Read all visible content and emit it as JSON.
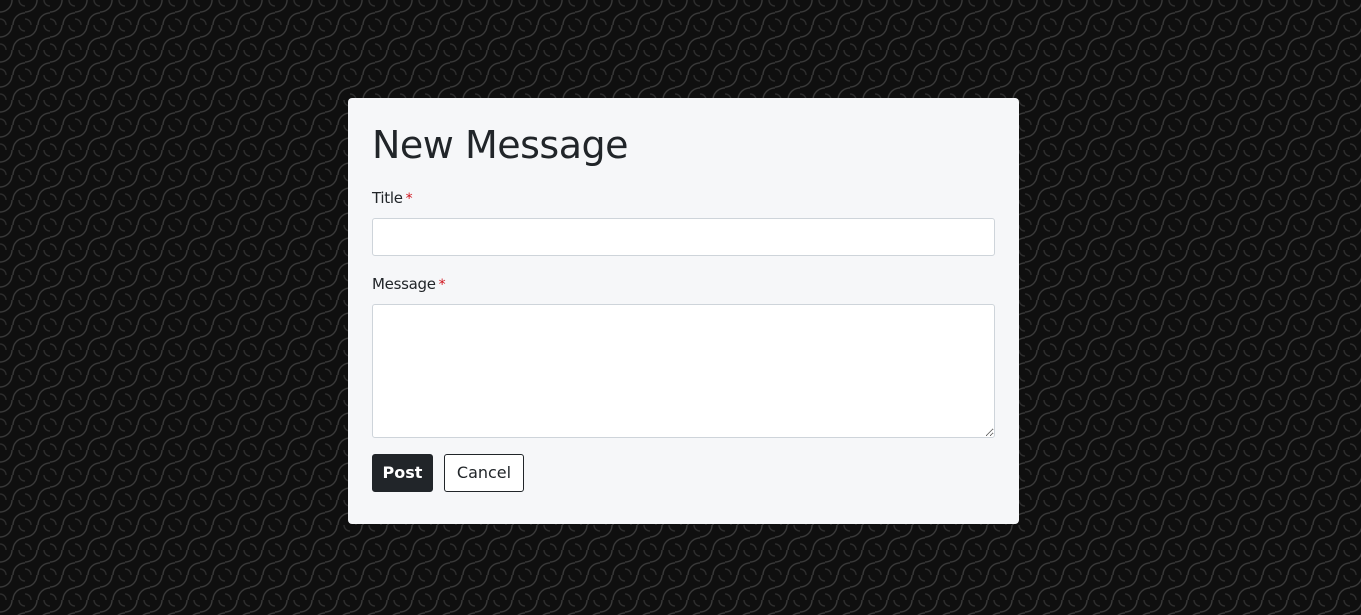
{
  "dialog": {
    "heading": "New Message",
    "fields": {
      "title": {
        "label": "Title",
        "required_marker": "*",
        "value": "",
        "placeholder": ""
      },
      "message": {
        "label": "Message",
        "required_marker": "*",
        "value": "",
        "placeholder": ""
      }
    },
    "actions": {
      "post_label": "Post",
      "cancel_label": "Cancel"
    }
  },
  "colors": {
    "background": "#0f0f0f",
    "card": "#f6f7f9",
    "primary_button": "#212529",
    "required": "#d0101a"
  }
}
